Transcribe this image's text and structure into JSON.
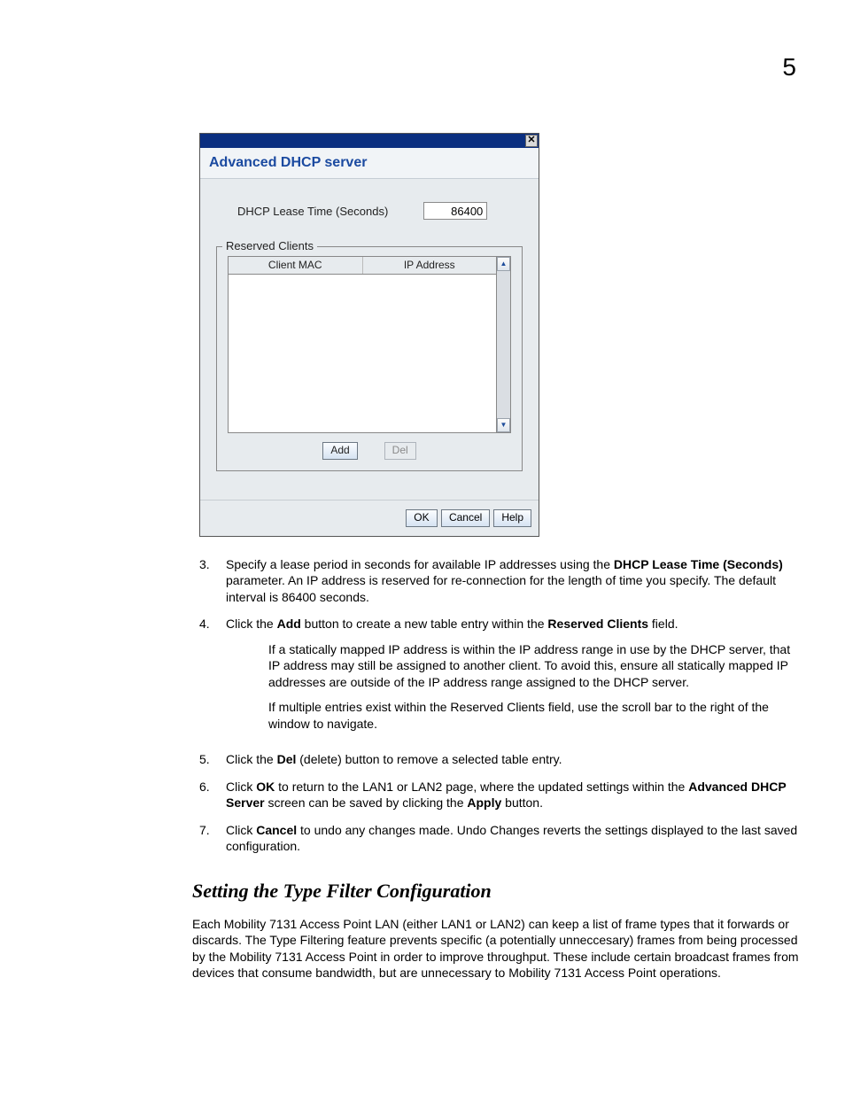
{
  "page_number": "5",
  "dialog": {
    "title": "Advanced DHCP server",
    "close_glyph": "✕",
    "lease_label": "DHCP Lease Time (Seconds)",
    "lease_value": "86400",
    "fieldset_legend": "Reserved Clients",
    "col1": "Client MAC",
    "col2": "IP Address",
    "scroll_up": "▲",
    "scroll_down": "▼",
    "add_label": "Add",
    "del_label": "Del",
    "ok_label": "OK",
    "cancel_label": "Cancel",
    "help_label": "Help"
  },
  "steps": {
    "s3_num": "3.",
    "s3a": "Specify a lease period in seconds for available IP addresses using the ",
    "s3b": "DHCP Lease Time (Seconds)",
    "s3c": " parameter. An IP address is reserved for re-connection for the length of time you specify. The default interval is 86400 seconds.",
    "s4_num": "4.",
    "s4a": "Click the ",
    "s4b": "Add",
    "s4c": " button to create a new table entry within the ",
    "s4d": "Reserved Clients",
    "s4e": " field.",
    "s4_sub1": "If a statically mapped IP address is within the IP address range in use by the DHCP server, that IP address may still be assigned to another client. To avoid this, ensure all statically mapped IP addresses are outside of the IP address range assigned to the DHCP server.",
    "s4_sub2": "If multiple entries exist within the Reserved Clients field, use the scroll bar to the right of the window to navigate.",
    "s5_num": "5.",
    "s5a": "Click the ",
    "s5b": "Del",
    "s5c": " (delete) button to remove a selected table entry.",
    "s6_num": "6.",
    "s6a": "Click ",
    "s6b": "OK",
    "s6c": " to return to the LAN1 or LAN2 page, where the updated settings within the ",
    "s6d": "Advanced DHCP Server",
    "s6e": " screen can be saved by clicking the ",
    "s6f": "Apply",
    "s6g": " button.",
    "s7_num": "7.",
    "s7a": "Click ",
    "s7b": "Cancel",
    "s7c": " to undo any changes made. Undo Changes reverts the settings displayed to the last saved configuration."
  },
  "section": {
    "title": "Setting the Type Filter Configuration",
    "para": "Each Mobility 7131 Access Point LAN (either LAN1 or LAN2) can keep a list of frame types that it forwards or discards. The Type Filtering feature prevents specific (a potentially unneccesary) frames from being processed by the Mobility 7131 Access Point in order to improve throughput. These include certain broadcast frames from devices that consume bandwidth, but are unnecessary to Mobility 7131 Access Point operations."
  }
}
